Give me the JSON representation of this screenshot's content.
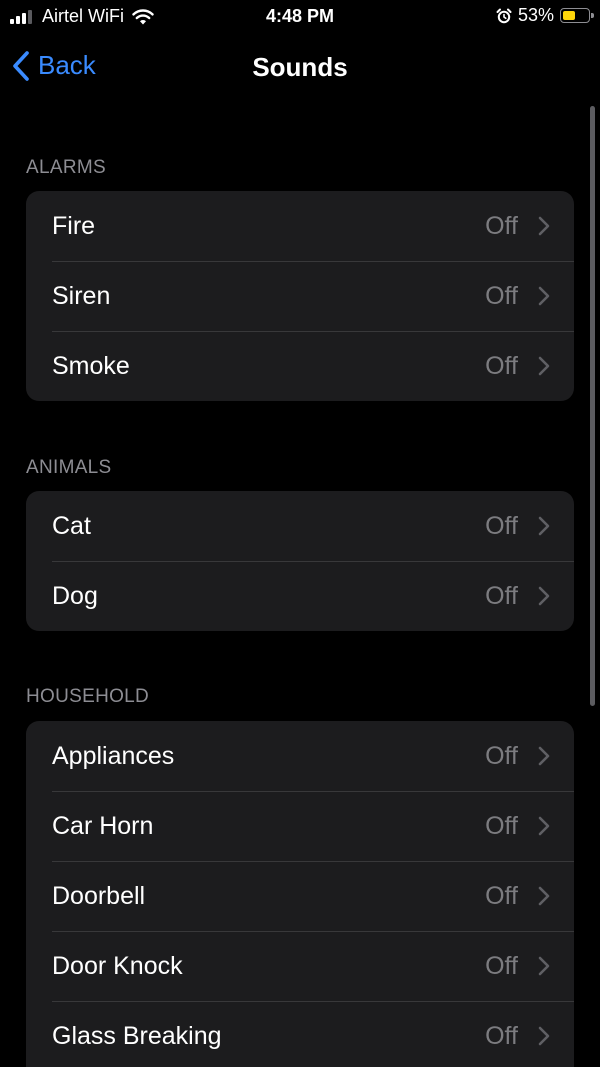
{
  "status_bar": {
    "carrier": "Airtel WiFi",
    "time": "4:48 PM",
    "battery_percent": "53%",
    "battery_level": 0.53,
    "signal_bars": 3,
    "icons": [
      "signal-icon",
      "wifi-icon",
      "alarm-clock-icon",
      "battery-icon"
    ],
    "battery_color": "#ffd60a"
  },
  "nav": {
    "back_label": "Back",
    "title": "Sounds"
  },
  "colors": {
    "accent": "#3a8bff",
    "background": "#000000",
    "group_background": "#1c1c1e",
    "secondary_text": "#8d8d93"
  },
  "sections": [
    {
      "header": "ALARMS",
      "items": [
        {
          "label": "Fire",
          "value": "Off"
        },
        {
          "label": "Siren",
          "value": "Off"
        },
        {
          "label": "Smoke",
          "value": "Off"
        }
      ]
    },
    {
      "header": "ANIMALS",
      "items": [
        {
          "label": "Cat",
          "value": "Off"
        },
        {
          "label": "Dog",
          "value": "Off"
        }
      ]
    },
    {
      "header": "HOUSEHOLD",
      "items": [
        {
          "label": "Appliances",
          "value": "Off"
        },
        {
          "label": "Car Horn",
          "value": "Off"
        },
        {
          "label": "Doorbell",
          "value": "Off"
        },
        {
          "label": "Door Knock",
          "value": "Off"
        },
        {
          "label": "Glass Breaking",
          "value": "Off"
        }
      ]
    }
  ]
}
